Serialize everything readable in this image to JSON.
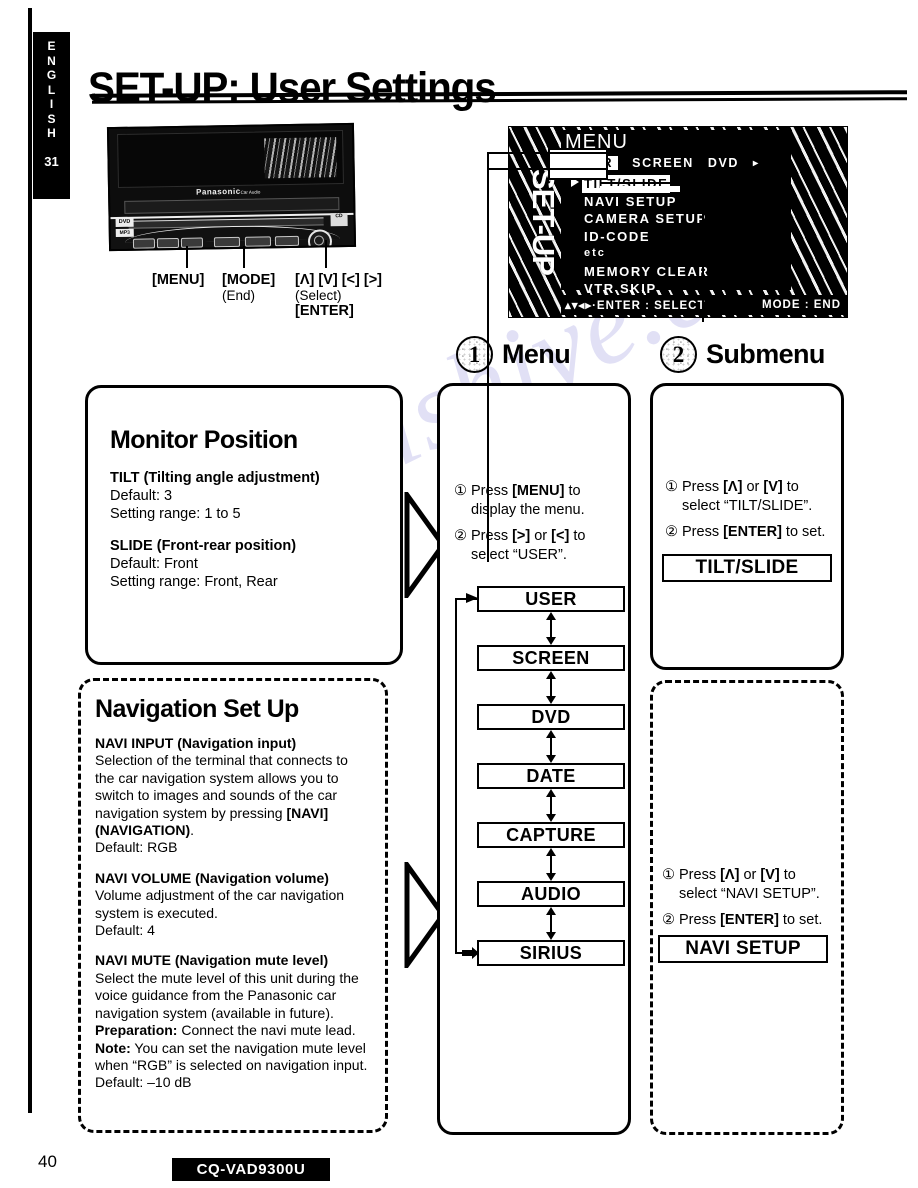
{
  "page": {
    "title": "SET-UP: User Settings",
    "language_tab": {
      "label": "ENGLISH",
      "page_ref": "31"
    },
    "footer": {
      "page_number": "40",
      "model": "CQ-VAD9300U"
    },
    "watermark": "manualshive.com"
  },
  "device": {
    "brand": "Panasonic",
    "brand_sub": "Car Audio",
    "badge_dvd": "DVD",
    "badge_mp3": "MP3",
    "badge_cd": "CD",
    "button_labels": [
      {
        "main": "[MENU]",
        "sub": ""
      },
      {
        "main": "[MODE]",
        "sub": "(End)"
      },
      {
        "main": "[Λ] [V] [<] [>]",
        "sub": "(Select)"
      },
      {
        "main": "[ENTER]",
        "sub": ""
      }
    ]
  },
  "osd": {
    "side_label": "SET-UP",
    "title": "MENU",
    "tabs": [
      {
        "label": "USER",
        "selected": true
      },
      {
        "label": "SCREEN",
        "selected": false
      },
      {
        "label": "DVD",
        "selected": false
      },
      {
        "label": "▸",
        "selected": false
      }
    ],
    "items": [
      {
        "label": "TILT/SLIDE",
        "current": true
      },
      {
        "label": "NAVI SETUP",
        "current": false
      },
      {
        "label": "CAMERA SETUP",
        "current": false
      },
      {
        "label": "ID-CODE",
        "current": false
      },
      {
        "label": "etc",
        "current": false
      },
      {
        "label": "MEMORY CLEAR",
        "current": false
      },
      {
        "label": "VTR SKIP",
        "current": false
      }
    ],
    "status_left": "▴▾◂▸·ENTER : SELECT",
    "status_right": "MODE : END"
  },
  "steps": [
    {
      "number": "1",
      "label": "Menu"
    },
    {
      "number": "2",
      "label": "Submenu"
    }
  ],
  "cards": {
    "monitor_position": {
      "title": "Monitor Position",
      "sections": [
        {
          "heading_bold": "TILT",
          "heading_rest": "(Tilting angle adjustment)",
          "lines": [
            "Default: 3",
            "Setting range: 1 to 5"
          ]
        },
        {
          "heading_bold": "SLIDE",
          "heading_rest": "(Front-rear position)",
          "lines": [
            "Default: Front",
            "Setting range: Front, Rear"
          ]
        }
      ]
    },
    "navigation_setup": {
      "title": "Navigation Set Up",
      "sections": [
        {
          "heading_bold": "NAVI INPUT",
          "heading_rest": "(Navigation input)",
          "body_pre": "Selection of the terminal that connects to the car navigation system allows you to switch to images and sounds of the car navigation sys­tem by pressing ",
          "body_bold": "[NAVI] (NAVIGATION)",
          "body_post": ".",
          "lines": [
            "Default: RGB"
          ]
        },
        {
          "heading_bold": "NAVI VOLUME",
          "heading_rest": "(Navigation volume)",
          "body_pre": "Volume adjustment of the car navigation sys­tem is executed.",
          "body_bold": "",
          "body_post": "",
          "lines": [
            "Default: 4"
          ]
        },
        {
          "heading_bold": "NAVI MUTE",
          "heading_rest": "(Navigation mute level)",
          "body_pre": "Select the mute level of this unit during the voice guidance from the Panasonic car naviga­tion system (available in future).",
          "body_bold": "",
          "body_post": "",
          "note_label_1": "Preparation:",
          "note_text_1": " Connect the navi mute lead.",
          "note_label_2": "Note:",
          "note_text_2": " You can set the navigation mute level when “RGB” is selected on navigation input.",
          "lines": [
            "Default: –10 dB"
          ]
        }
      ]
    }
  },
  "menu_column": {
    "instructions": [
      {
        "num": "①",
        "pre": "Press ",
        "bold": "[MENU]",
        "post": " to display the menu."
      },
      {
        "num": "②",
        "pre": "Press ",
        "bold": "[>]",
        "mid": " or ",
        "bold2": "[<]",
        "post": " to select “USER”."
      }
    ],
    "flow_items": [
      "USER",
      "SCREEN",
      "DVD",
      "DATE",
      "CAPTURE",
      "AUDIO",
      "SIRIUS"
    ]
  },
  "submenu_column": {
    "block_1": {
      "instructions": [
        {
          "num": "①",
          "pre": "Press ",
          "bold": "[Λ]",
          "mid": " or ",
          "bold2": "[V]",
          "post": " to select “TILT/SLIDE”."
        },
        {
          "num": "②",
          "pre": "Press ",
          "bold": "[ENTER]",
          "post": " to set."
        }
      ],
      "result": "TILT/SLIDE"
    },
    "block_2": {
      "instructions": [
        {
          "num": "①",
          "pre": "Press ",
          "bold": "[Λ]",
          "mid": " or ",
          "bold2": "[V]",
          "post": " to select “NAVI SETUP”."
        },
        {
          "num": "②",
          "pre": "Press ",
          "bold": "[ENTER]",
          "post": " to set."
        }
      ],
      "result": "NAVI SETUP"
    }
  },
  "colors": {
    "ink": "#000000",
    "paper": "#ffffff",
    "watermark": "#c9c8ee"
  }
}
